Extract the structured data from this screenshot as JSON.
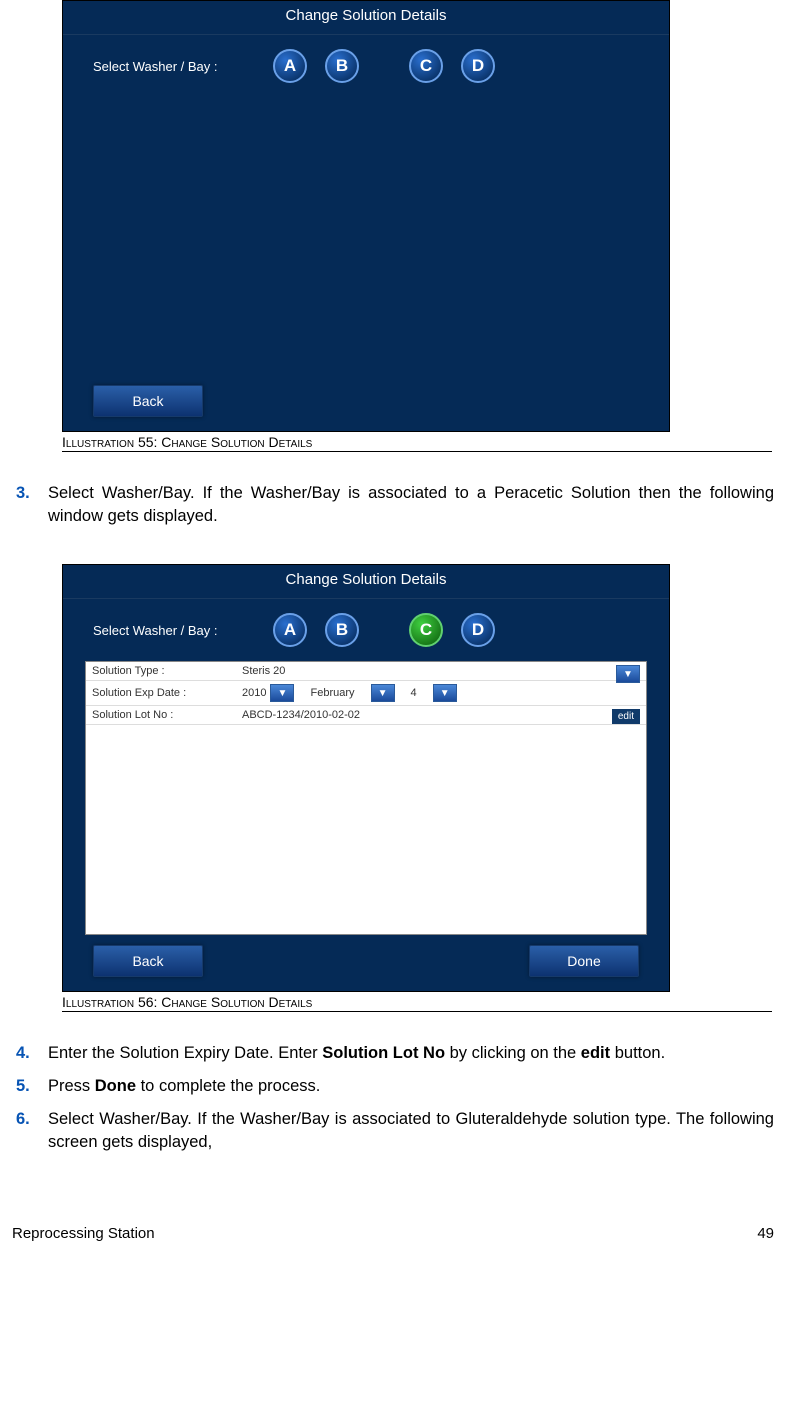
{
  "illus1": {
    "title": "Change Solution Details",
    "select_label": "Select Washer / Bay :",
    "bays": [
      "A",
      "B",
      "C",
      "D"
    ],
    "back": "Back",
    "caption": "Illustration 55: Change Solution Details"
  },
  "illus2": {
    "title": "Change Solution Details",
    "select_label": "Select Washer / Bay :",
    "bays": [
      "A",
      "B",
      "C",
      "D"
    ],
    "form": {
      "type_label": "Solution Type :",
      "type_value": "Steris 20",
      "exp_label": "Solution Exp Date :",
      "exp_year": "2010",
      "exp_month": "February",
      "exp_day": "4",
      "lot_label": "Solution Lot No :",
      "lot_value": "ABCD-1234/2010-02-02",
      "edit": "edit"
    },
    "back": "Back",
    "done": "Done",
    "caption": "Illustration 56: Change Solution Details"
  },
  "steps": {
    "s3_num": "3.",
    "s3": "Select Washer/Bay. If the Washer/Bay is associated  to a Peracetic Solution then the following window gets displayed.",
    "s4_num": "4.",
    "s4_a": "Enter the Solution Expiry Date. Enter ",
    "s4_b": "Solution Lot No",
    "s4_c": " by clicking on the ",
    "s4_d": "edit",
    "s4_e": " button.",
    "s5_num": "5.",
    "s5_a": "Press ",
    "s5_b": "Done",
    "s5_c": " to complete the process.",
    "s6_num": "6.",
    "s6": "Select Washer/Bay. If the Washer/Bay is associated to Gluteraldehyde solution type. The following screen gets displayed,"
  },
  "footer": {
    "left": "Reprocessing Station",
    "right": "49"
  }
}
